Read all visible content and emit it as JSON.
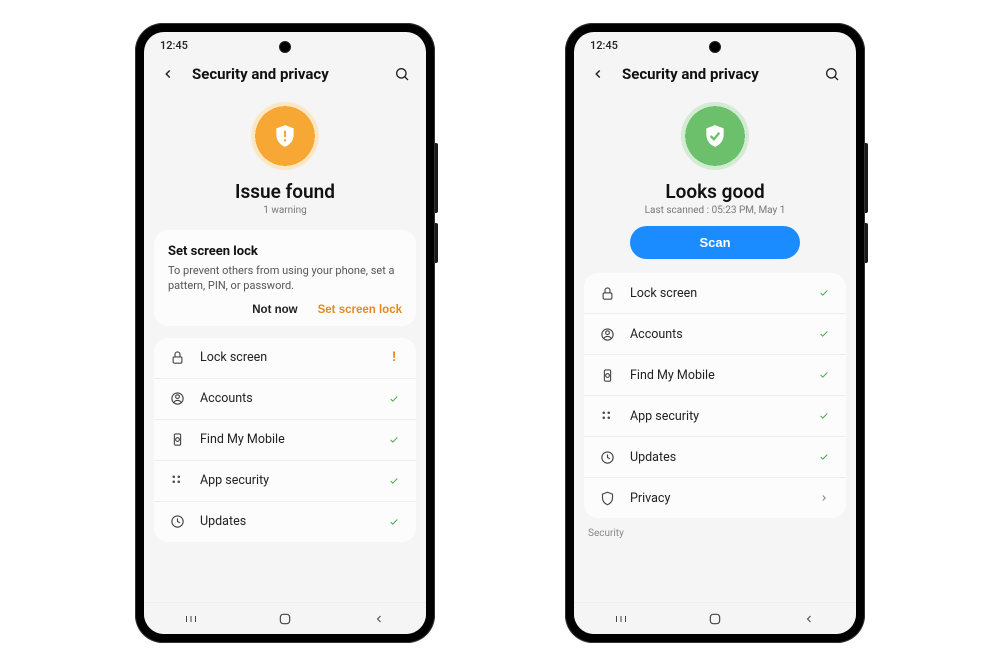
{
  "phones": [
    {
      "status_time": "12:45",
      "header_title": "Security and privacy",
      "hero": {
        "state": "warn",
        "title": "Issue found",
        "subtitle": "1 warning"
      },
      "card": {
        "title": "Set screen lock",
        "description": "To prevent others from using your phone, set a pattern, PIN, or password.",
        "action_secondary": "Not now",
        "action_primary": "Set screen lock"
      },
      "items": [
        {
          "icon": "lock",
          "label": "Lock screen",
          "status": "warn"
        },
        {
          "icon": "account",
          "label": "Accounts",
          "status": "ok"
        },
        {
          "icon": "find",
          "label": "Find My Mobile",
          "status": "ok"
        },
        {
          "icon": "apps",
          "label": "App security",
          "status": "ok"
        },
        {
          "icon": "update",
          "label": "Updates",
          "status": "ok"
        }
      ]
    },
    {
      "status_time": "12:45",
      "header_title": "Security and privacy",
      "hero": {
        "state": "good",
        "title": "Looks good",
        "subtitle": "Last scanned : 05:23 PM, May 1",
        "scan_label": "Scan"
      },
      "items": [
        {
          "icon": "lock",
          "label": "Lock screen",
          "status": "ok"
        },
        {
          "icon": "account",
          "label": "Accounts",
          "status": "ok"
        },
        {
          "icon": "find",
          "label": "Find My Mobile",
          "status": "ok"
        },
        {
          "icon": "apps",
          "label": "App security",
          "status": "ok"
        },
        {
          "icon": "update",
          "label": "Updates",
          "status": "ok"
        },
        {
          "icon": "privacy",
          "label": "Privacy",
          "status": "chevron"
        }
      ],
      "section_label": "Security"
    }
  ]
}
